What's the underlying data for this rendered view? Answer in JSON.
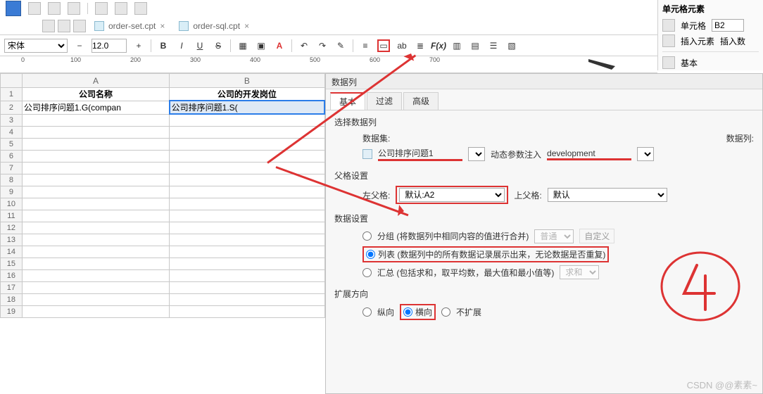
{
  "top": {
    "tabs": [
      {
        "file": "order-set.cpt"
      },
      {
        "file": "order-sql.cpt"
      }
    ]
  },
  "fmt": {
    "font": "宋体",
    "size": "12.0",
    "bold": "B",
    "italic": "I",
    "underline": "U",
    "strike": "S",
    "fx": "F(x)"
  },
  "right": {
    "title": "单元格元素",
    "cell_label": "单元格",
    "cell_value": "B2",
    "insert_label": "插入元素",
    "insert_btn": "插入数",
    "basic": "基本"
  },
  "ruler": {
    "marks": [
      "0",
      "100",
      "200",
      "300",
      "400",
      "500",
      "600",
      "700"
    ]
  },
  "sheet": {
    "cols": [
      "A",
      "B"
    ],
    "head": {
      "A": "公司名称",
      "B": "公司的开发岗位"
    },
    "row2": {
      "A": "公司排序问题1.G(compan",
      "B": "公司排序问题1.S("
    }
  },
  "dialog": {
    "title": "数据列",
    "tabs": {
      "basic": "基本",
      "filter": "过滤",
      "adv": "高级"
    },
    "select_label": "选择数据列",
    "dataset_label": "数据集:",
    "dataset_value": "公司排序问题1",
    "dyn_param": "动态参数注入",
    "datacol_label": "数据列:",
    "datacol_value": "development",
    "parent_label": "父格设置",
    "left_parent": "左父格:",
    "left_parent_val": "默认:A2",
    "up_parent": "上父格:",
    "up_parent_val": "默认",
    "data_setting": "数据设置",
    "group_label": "分组 (将数据列中相同内容的值进行合并)",
    "group_mode": "普通",
    "group_custom": "自定义",
    "list_label": "列表 (数据列中的所有数据记录展示出来，无论数据是否重复)",
    "sum_label": "汇总 (包括求和，取平均数，最大值和最小值等)",
    "sum_mode": "求和",
    "expand_label": "扩展方向",
    "expand_v": "纵向",
    "expand_h": "横向",
    "expand_none": "不扩展"
  },
  "watermark": "CSDN @@素素~"
}
